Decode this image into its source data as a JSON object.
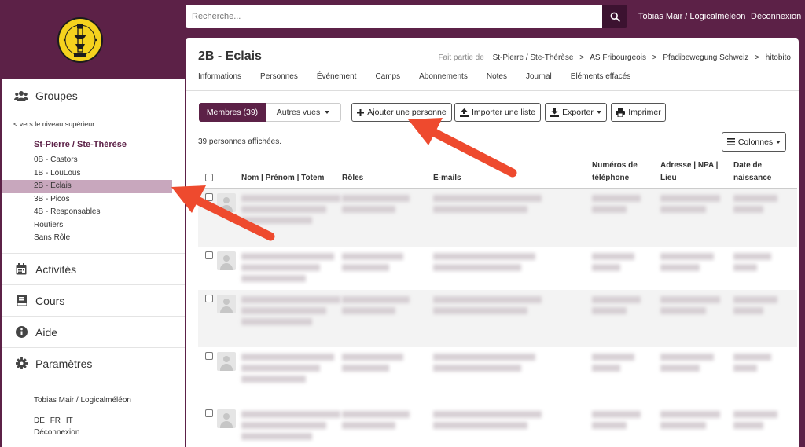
{
  "search": {
    "placeholder": "Recherche..."
  },
  "topbar": {
    "user": "Tobias Mair / Logicalméléon",
    "logout": "Déconnexion"
  },
  "sidebar": {
    "groups_label": "Groupes",
    "back_link": "< vers le niveau supérieur",
    "group_title": "St-Pierre / Ste-Thérèse",
    "items": [
      "0B - Castors",
      "1B - LouLous",
      "2B - Eclais",
      "3B - Picos",
      "4B - Responsables",
      "Routiers",
      "Sans Rôle"
    ],
    "active_item": "2B - Eclais",
    "sections": [
      "Activités",
      "Cours",
      "Aide",
      "Paramètres"
    ],
    "footer_user": "Tobias Mair / Logicalméléon",
    "languages": [
      "DE",
      "FR",
      "IT"
    ],
    "footer_logout": "Déconnexion"
  },
  "page": {
    "title": "2B - Eclais",
    "breadcrumb_label": "Fait partie de",
    "breadcrumb": [
      "St-Pierre / Ste-Thérèse",
      "AS Fribourgeois",
      "Pfadibewegung Schweiz",
      "hitobito"
    ],
    "tabs": [
      "Informations",
      "Personnes",
      "Événement",
      "Camps",
      "Abonnements",
      "Notes",
      "Journal",
      "Eléments effacés"
    ],
    "active_tab": "Personnes"
  },
  "toolbar": {
    "members": "Membres (39)",
    "other_views": "Autres vues",
    "add_person": "Ajouter une personne",
    "import_list": "Importer une liste",
    "export": "Exporter",
    "print": "Imprimer",
    "columns": "Colonnes"
  },
  "table": {
    "count_text": "39 personnes affichées.",
    "headers": {
      "name": "Nom | Prénom | Totem",
      "roles": "Rôles",
      "emails": "E-mails",
      "phones": "Numéros de téléphone",
      "address": "Adresse | NPA | Lieu",
      "birthdate": "Date de naissance"
    }
  },
  "colors": {
    "brand": "#5c2147",
    "active_item": "#c8a7bd",
    "arrow": "#ee4a2e"
  }
}
